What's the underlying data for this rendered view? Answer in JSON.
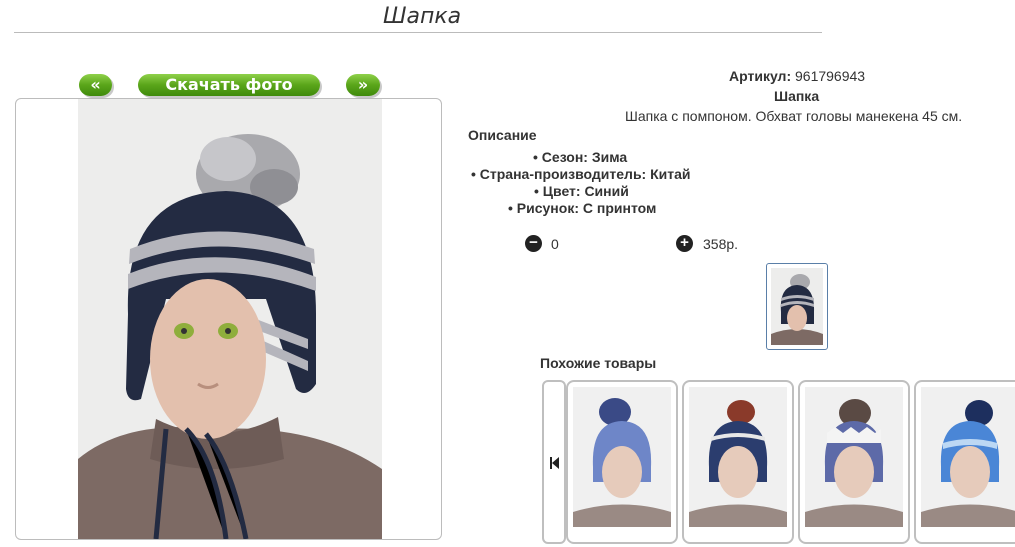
{
  "product": {
    "title": "Шапка",
    "sku_label": "Артикул:",
    "sku_value": "961796943",
    "name": "Шапка",
    "short_description": "Шапка с помпоном. Обхват головы манекена 45 см."
  },
  "photo_nav": {
    "prev_label": "«",
    "download_label": "Скачать фото",
    "next_label": "»"
  },
  "description": {
    "heading": "Описание",
    "properties": [
      "• Сезон: Зима",
      "• Страна-производитель: Китай",
      "• Цвет: Синий",
      "• Рисунок: С принтом"
    ]
  },
  "cart": {
    "minus_icon": "minus-circle-icon",
    "quantity": "0",
    "plus_icon": "plus-circle-icon",
    "price": "358р."
  },
  "similar": {
    "heading": "Похожие товары",
    "nav_icon": "skip-back-icon",
    "cards": [
      {
        "name": "similar-hat-1",
        "color": "#6e86c8"
      },
      {
        "name": "similar-hat-2",
        "color": "#2b3d6e"
      },
      {
        "name": "similar-hat-3",
        "color": "#5d6aa8"
      },
      {
        "name": "similar-hat-4",
        "color": "#4a86d6"
      }
    ]
  },
  "colors": {
    "accent_green": "#5aa51a",
    "hat_navy": "#222b44",
    "stripe_gray": "#b8b8c0"
  }
}
